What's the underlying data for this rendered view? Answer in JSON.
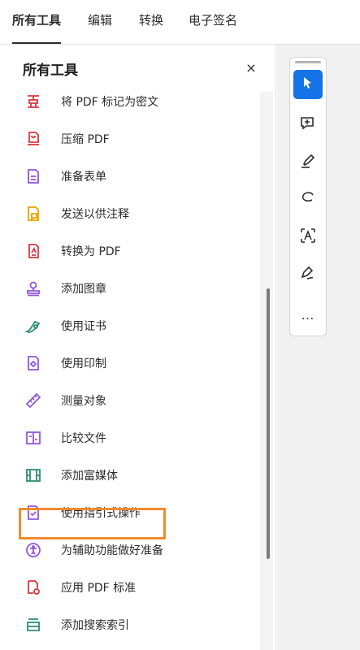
{
  "top_tabs": [
    {
      "label": "所有工具"
    },
    {
      "label": "编辑"
    },
    {
      "label": "转换"
    },
    {
      "label": "电子签名"
    }
  ],
  "panel": {
    "title": "所有工具",
    "close_label": "×",
    "tools": [
      {
        "label": "将 PDF 标记为密文",
        "icon": "redact-icon",
        "color": "#d7373f"
      },
      {
        "label": "压缩 PDF",
        "icon": "compress-pdf-icon",
        "color": "#d7373f"
      },
      {
        "label": "准备表单",
        "icon": "prepare-form-icon",
        "color": "#9256d9"
      },
      {
        "label": "发送以供注释",
        "icon": "send-for-comments-icon",
        "color": "#e8a300"
      },
      {
        "label": "转换为 PDF",
        "icon": "create-pdf-icon",
        "color": "#d7373f"
      },
      {
        "label": "添加图章",
        "icon": "stamp-icon",
        "color": "#9256d9"
      },
      {
        "label": "使用证书",
        "icon": "certificate-icon",
        "color": "#2d8e74"
      },
      {
        "label": "使用印制",
        "icon": "print-production-icon",
        "color": "#9256d9"
      },
      {
        "label": "测量对象",
        "icon": "measure-icon",
        "color": "#9256d9"
      },
      {
        "label": "比较文件",
        "icon": "compare-files-icon",
        "color": "#9256d9"
      },
      {
        "label": "添加富媒体",
        "icon": "rich-media-icon",
        "color": "#2d8e74"
      },
      {
        "label": "使用指引式操作",
        "icon": "guided-actions-icon",
        "color": "#9256d9",
        "highlighted": true
      },
      {
        "label": "为辅助功能做好准备",
        "icon": "accessibility-icon",
        "color": "#9256d9"
      },
      {
        "label": "应用 PDF 标准",
        "icon": "pdf-standards-icon",
        "color": "#d7373f"
      },
      {
        "label": "添加搜索索引",
        "icon": "search-index-icon",
        "color": "#2d8e74"
      }
    ]
  },
  "quick_tools": {
    "items": [
      "select-cursor-icon",
      "add-comment-icon",
      "highlight-icon",
      "draw-icon",
      "add-text-icon",
      "sign-icon"
    ],
    "more_label": "…"
  },
  "colors": {
    "accent": "#1473e6",
    "highlight_border": "#f28a2e"
  }
}
